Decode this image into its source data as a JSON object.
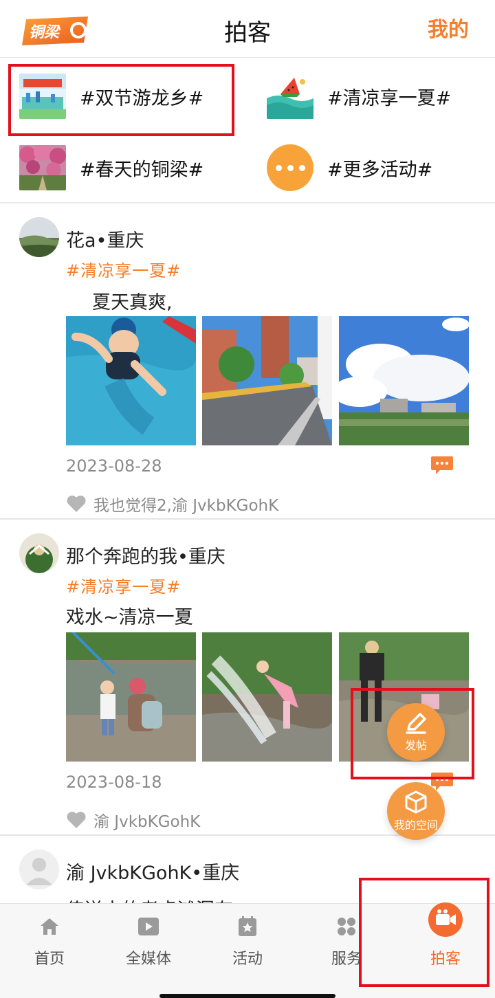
{
  "header": {
    "logo_text": "铜梁",
    "title": "拍客",
    "my_label": "我的"
  },
  "topics": [
    {
      "label": "#双节游龙乡#",
      "thumb_caption": "国庆 · 中秋 双节游龙乡"
    },
    {
      "label": "#清凉享一夏#"
    },
    {
      "label": "#春天的铜梁#"
    },
    {
      "label": "#更多活动#"
    }
  ],
  "posts": [
    {
      "author": "花a•重庆",
      "tag": "#清凉享一夏#",
      "text": "夏天真爽,",
      "date": "2023-08-28",
      "likes": "我也觉得2,渝 JvkbKGohK"
    },
    {
      "author": "那个奔跑的我•重庆",
      "tag": "#清凉享一夏#",
      "text": "戏水~清凉一夏",
      "date": "2023-08-18",
      "likes": "渝 JvkbKGohK"
    },
    {
      "author": "渝 JvkbKGohK•重庆",
      "text": "传送中的孝虎滩漏有"
    }
  ],
  "fab": {
    "post_label": "发帖",
    "space_label": "我的空间"
  },
  "tabs": [
    {
      "label": "首页",
      "icon": "home-icon"
    },
    {
      "label": "全媒体",
      "icon": "play-icon"
    },
    {
      "label": "活动",
      "icon": "star-calendar-icon"
    },
    {
      "label": "服务",
      "icon": "grid-icon"
    },
    {
      "label": "拍客",
      "icon": "video-camera-icon",
      "active": true
    }
  ],
  "colors": {
    "accent": "#f57e2a",
    "highlight_box": "#e3101b",
    "fab": "#f39a43"
  }
}
